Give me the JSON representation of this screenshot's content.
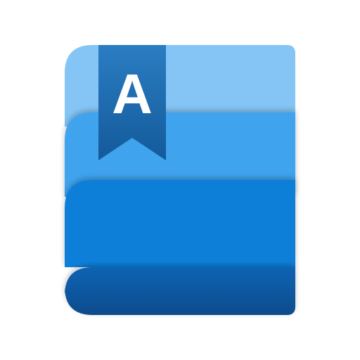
{
  "app_icon": {
    "name": "book-with-bookmark",
    "letter": "A",
    "colors": {
      "background": "#ffffff",
      "layer_top": "#84C5F5",
      "layer_upper_mid": "#3FA3EE",
      "layer_lower_mid": "#0F7FD8",
      "layer_bottom": "#0D5FAD",
      "layer_bottom_shade": "#0A4E90",
      "ribbon": "#1B6FB5",
      "ribbon_dark": "#155C99",
      "letter": "#ffffff"
    }
  }
}
